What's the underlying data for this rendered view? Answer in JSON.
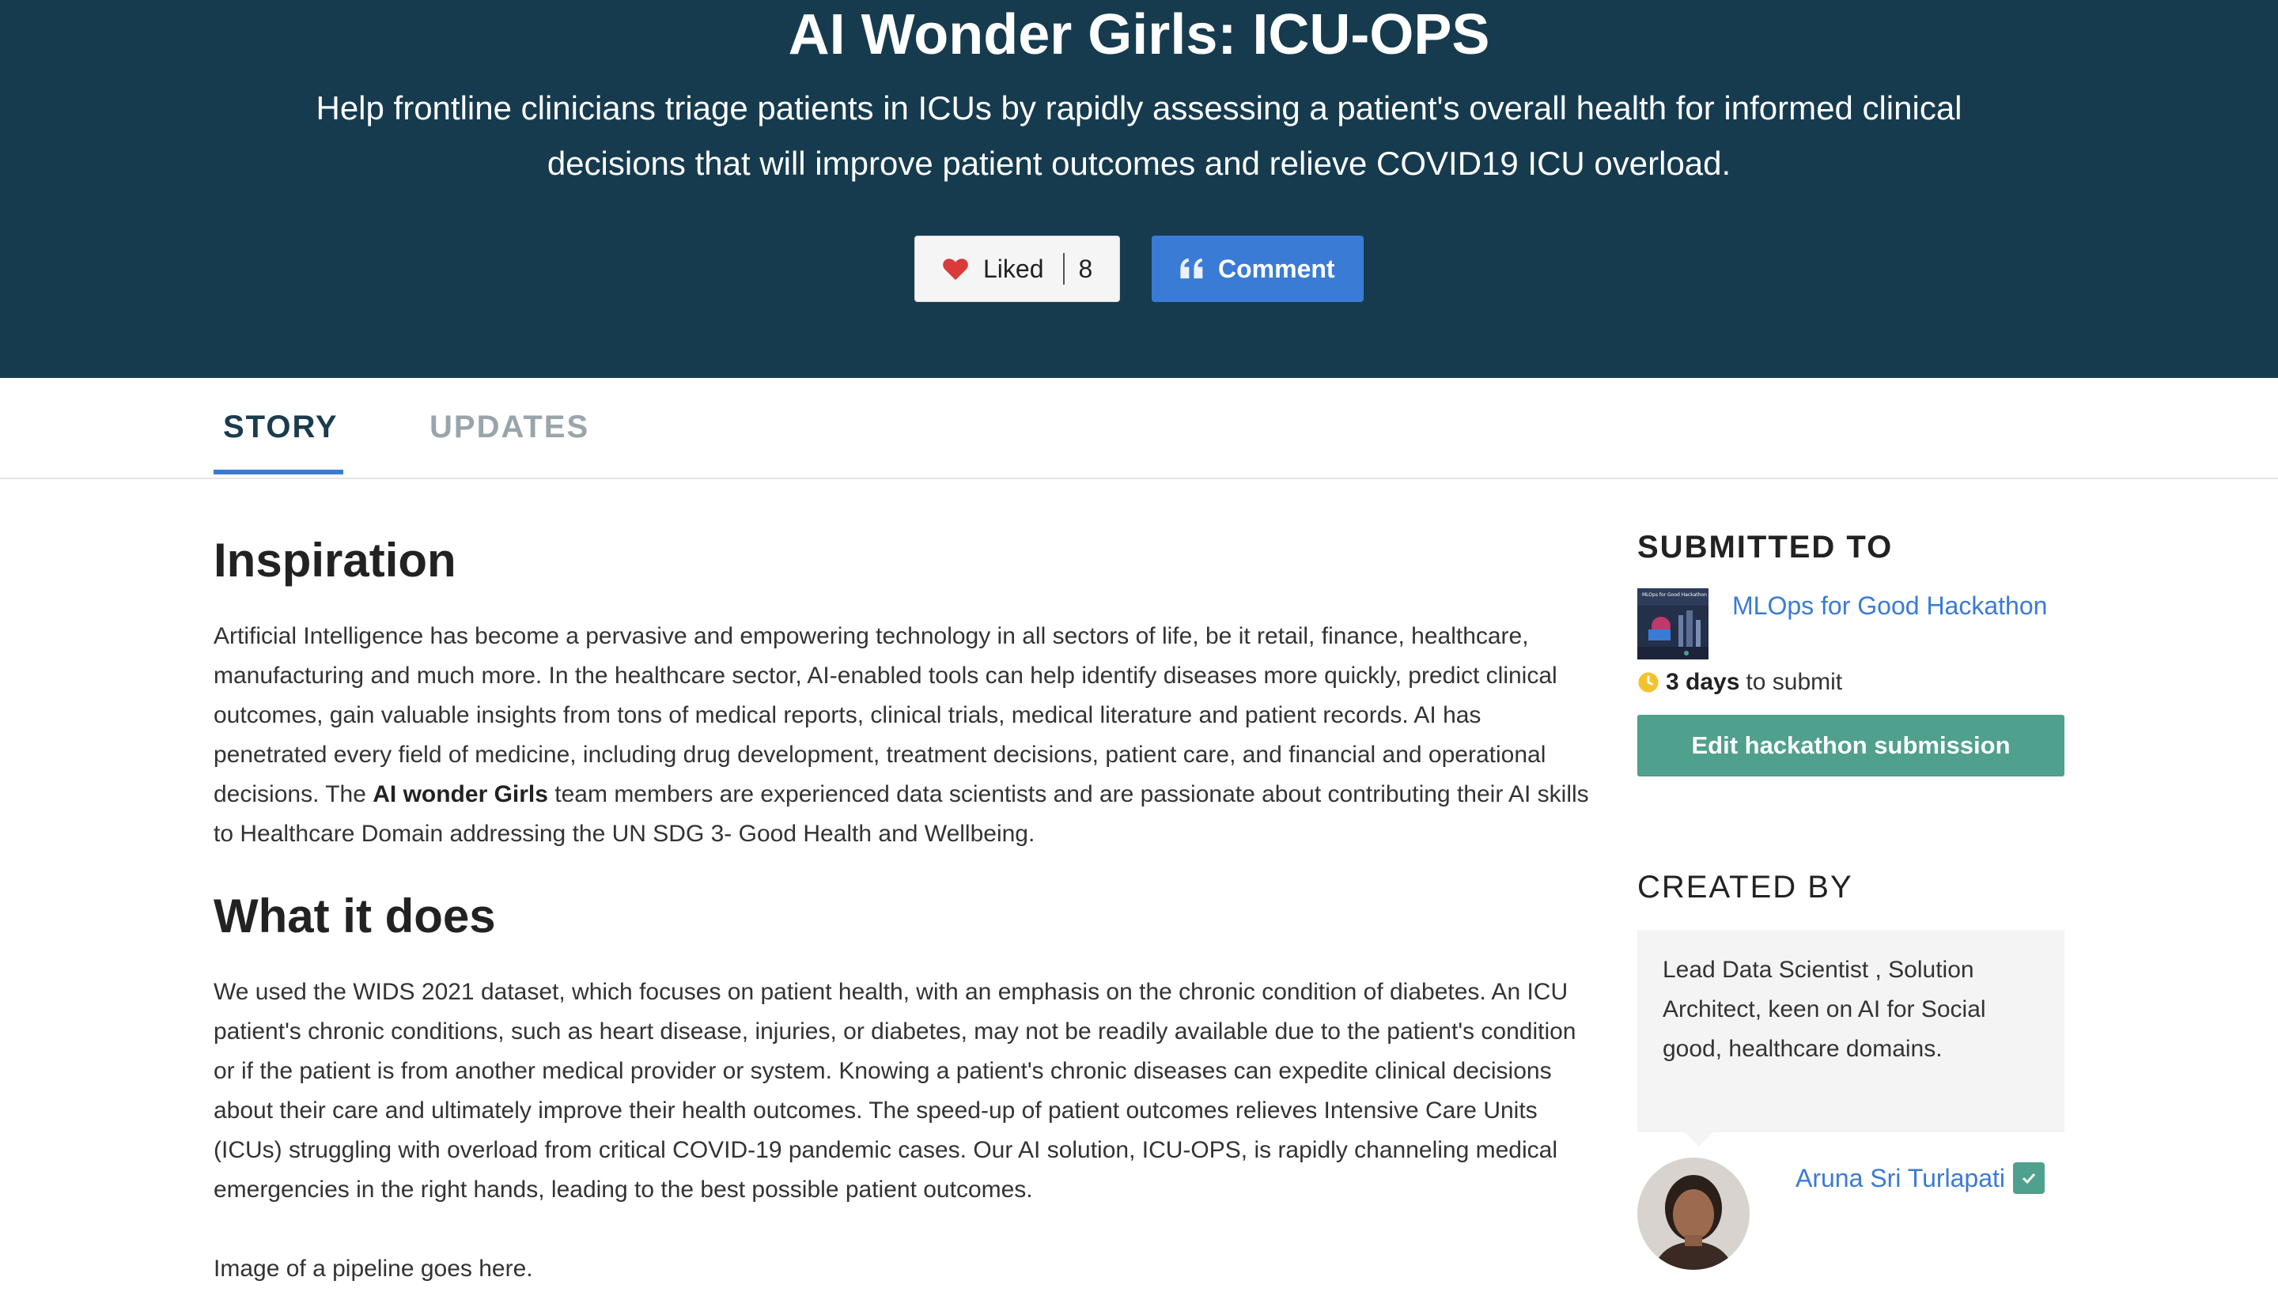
{
  "hero": {
    "title": "AI Wonder Girls: ICU-OPS",
    "subtitle_line1": "Help frontline clinicians triage patients in ICUs by rapidly assessing a patient's overall health for informed clinical",
    "subtitle_line2": "decisions that will improve patient outcomes and relieve COVID19 ICU overload.",
    "like_label": "Liked",
    "like_count": "8",
    "comment_label": "Comment"
  },
  "tabs": [
    {
      "label": "STORY",
      "active": true
    },
    {
      "label": "UPDATES",
      "active": false
    }
  ],
  "story": {
    "sec1": {
      "title": "Inspiration",
      "text_before": "Artificial Intelligence has become a pervasive and empowering technology in all sectors of life, be it retail, finance, healthcare, manufacturing and much more. In the healthcare sector, AI-enabled tools can help identify diseases more quickly, predict clinical outcomes, gain valuable insights from tons of medical reports, clinical trials, medical literature and patient records. AI has penetrated every field of medicine, including drug development, treatment decisions, patient care, and financial and operational decisions. The ",
      "text_bold": "AI wonder Girls",
      "text_after": " team members are experienced data scientists and are passionate about contributing their AI skills to Healthcare Domain addressing the UN SDG 3- Good Health and Wellbeing."
    },
    "sec2": {
      "title": "What it does",
      "text": "We used the WIDS 2021 dataset, which focuses on patient health, with an emphasis on the chronic condition of diabetes. An ICU patient's chronic conditions, such as heart disease, injuries, or diabetes, may not be readily available due to the patient's condition or if the patient is from another medical provider or system. Knowing a patient's chronic diseases can expedite clinical decisions about their care and ultimately improve their health outcomes. The speed-up of patient outcomes relieves Intensive Care Units (ICUs) struggling with overload from critical COVID-19 pandemic cases. Our AI solution, ICU-OPS, is rapidly channeling medical emergencies in the right hands, leading to the best possible patient outcomes.",
      "extra": "Image of a pipeline goes here."
    }
  },
  "sidebar": {
    "submitted_heading": "SUBMITTED TO",
    "hackathon_name": "MLOps for Good Hackathon",
    "thumb_text": "MLOps for Good Hackathon",
    "deadline_bold": "3 days",
    "deadline_rest": "to submit",
    "edit_button": "Edit hackathon submission",
    "created_heading": "CREATED BY",
    "bio": "Lead Data Scientist , Solution Architect, keen on AI for Social good, healthcare domains.",
    "author_name": "Aruna Sri Turlapati"
  },
  "icons": {
    "like": "heart-icon",
    "comment": "quote-icon",
    "deadline": "clock-icon",
    "verified": "check-icon"
  },
  "colors": {
    "hero_bg": "#163b4f",
    "link": "#3a7bd5",
    "accent_green": "#4fa08d",
    "heart": "#d93a3a",
    "clock": "#f3c32f"
  }
}
